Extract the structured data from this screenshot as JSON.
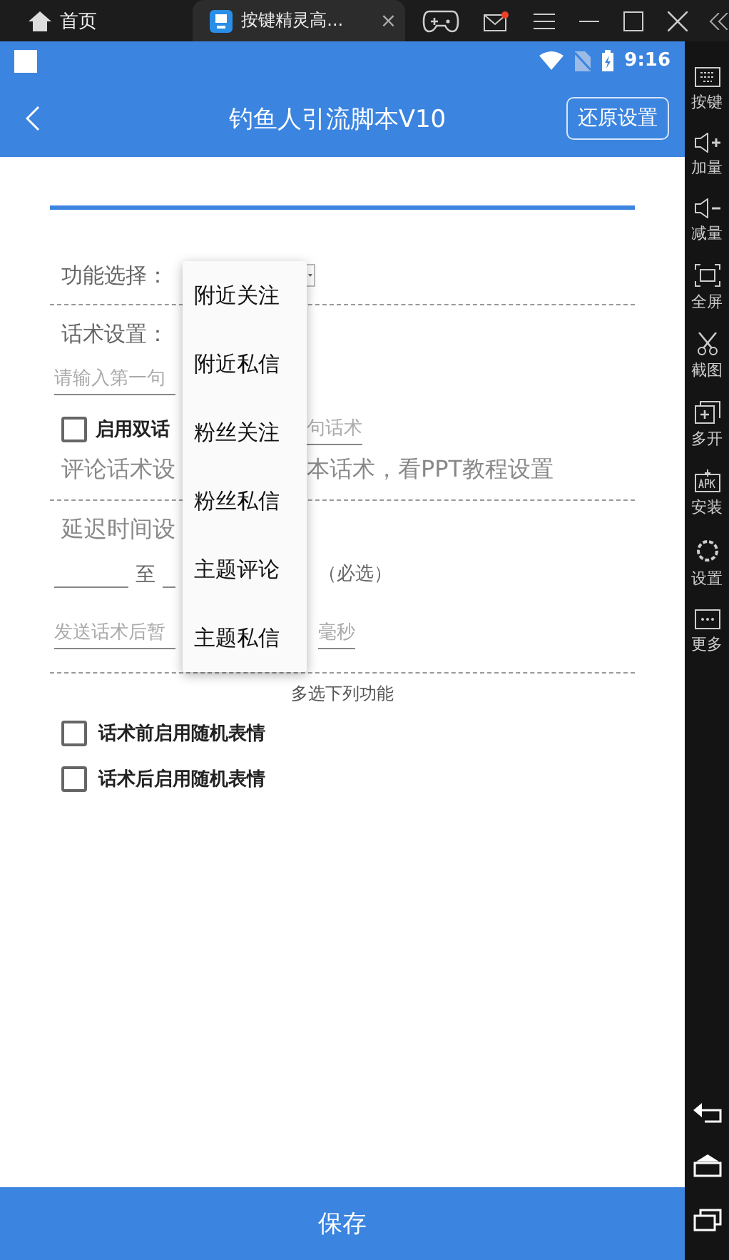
{
  "host_bar": {
    "home_label": "首页",
    "tab_title": "按键精灵高...",
    "tab_close": "×",
    "mail_unread": true
  },
  "status_bar": {
    "time": "9:16"
  },
  "app_bar": {
    "title": "钓鱼人引流脚本V10",
    "reset_button": "还原设置"
  },
  "form": {
    "function_label": "功能选择：",
    "script_label": "话术设置：",
    "first_input": {
      "placeholder": "请输入第一句"
    },
    "dual_option": {
      "label": "启用双话",
      "checked": false
    },
    "second_input": {
      "placeholder": "句话术"
    },
    "comment_left": "评论话术设",
    "comment_right": "本话术，看PPT教程设置",
    "delay_label": "延迟时间设",
    "delay_to": "至",
    "delay_unit": "（必选）",
    "pause_input": {
      "placeholder": "发送话术后暂",
      "placeholder_right": "毫秒"
    },
    "multi_title": "多选下列功能",
    "options": [
      {
        "label": "话术前启用随机表情",
        "checked": false
      },
      {
        "label": "话术后启用随机表情",
        "checked": false
      }
    ]
  },
  "dropdown_menu": [
    "附近关注",
    "附近私信",
    "粉丝关注",
    "粉丝私信",
    "主题评论",
    "主题私信"
  ],
  "save_button": "保存",
  "side_toolbar": [
    {
      "kind": "keyboard",
      "label": "按键"
    },
    {
      "kind": "volup",
      "label": "加量"
    },
    {
      "kind": "voldown",
      "label": "减量"
    },
    {
      "kind": "fullscreen",
      "label": "全屏"
    },
    {
      "kind": "scissors",
      "label": "截图"
    },
    {
      "kind": "multi",
      "label": "多开"
    },
    {
      "kind": "apk",
      "label": "安装"
    },
    {
      "kind": "settings",
      "label": "设置"
    },
    {
      "kind": "more",
      "label": "更多"
    }
  ]
}
